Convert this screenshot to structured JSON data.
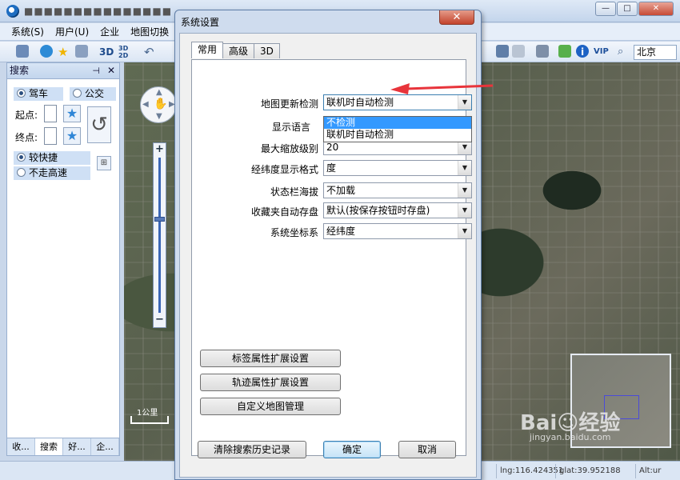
{
  "app": {
    "title": "■■■■■■■■■■■■■■■"
  },
  "window_controls": {
    "minimize": "—",
    "maximize": "□",
    "close": "✕"
  },
  "menu": [
    "系统(S)",
    "用户(U)",
    "企业",
    "地图切换"
  ],
  "toolbar": {
    "btn_3d": "3D",
    "btn_3d2d": "3D\n2D",
    "vip": "VIP",
    "city": "北京",
    "undo_arrow": "↶"
  },
  "left_panel": {
    "title": "搜索",
    "pin": "⊣",
    "close": "✕",
    "mode_drive": "驾车",
    "mode_bus": "公交",
    "start_label": "起点:",
    "end_label": "终点:",
    "opt_fast": "较快捷",
    "opt_no_highway": "不走高速",
    "tabs": [
      "收...",
      "搜索",
      "好...",
      "企..."
    ]
  },
  "map": {
    "scale_label": "1公里",
    "lng": "lng:116.424351",
    "lat": "glat:39.952188",
    "alt": "Alt:ur"
  },
  "watermark": {
    "brand": "Bai☺经验",
    "url": "jingyan.baidu.com"
  },
  "dialog": {
    "title": "系统设置",
    "close": "✕",
    "tabs": [
      "常用",
      "高级",
      "3D"
    ],
    "settings": [
      {
        "label": "地图更新检测",
        "value": "联机时自动检测"
      },
      {
        "label": "显示语言",
        "value": ""
      },
      {
        "label": "最大缩放级别",
        "value": "20"
      },
      {
        "label": "经纬度显示格式",
        "value": "度"
      },
      {
        "label": "状态栏海拔",
        "value": "不加载"
      },
      {
        "label": "收藏夹自动存盘",
        "value": "默认(按保存按钮时存盘)"
      },
      {
        "label": "系统坐标系",
        "value": "经纬度"
      }
    ],
    "dropdown_options": [
      "不检测",
      "联机时自动检测"
    ],
    "ext_buttons": [
      "标签属性扩展设置",
      "轨迹属性扩展设置",
      "自定义地图管理"
    ],
    "clear_history": "清除搜索历史记录",
    "ok": "确定",
    "cancel": "取消"
  },
  "colors": {
    "annotation_arrow": "#e8343b",
    "highlight": "#3399ff"
  }
}
